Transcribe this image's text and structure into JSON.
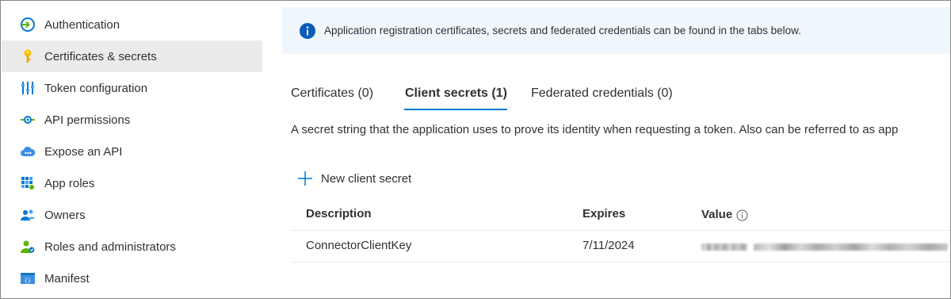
{
  "sidebar": {
    "items": [
      {
        "label": "Authentication",
        "icon": "authentication-icon",
        "active": false
      },
      {
        "label": "Certificates & secrets",
        "icon": "key-icon",
        "active": true
      },
      {
        "label": "Token configuration",
        "icon": "token-config-icon",
        "active": false
      },
      {
        "label": "API permissions",
        "icon": "api-permissions-icon",
        "active": false
      },
      {
        "label": "Expose an API",
        "icon": "cloud-icon",
        "active": false
      },
      {
        "label": "App roles",
        "icon": "app-roles-icon",
        "active": false
      },
      {
        "label": "Owners",
        "icon": "owners-icon",
        "active": false
      },
      {
        "label": "Roles and administrators",
        "icon": "roles-admin-icon",
        "active": false
      },
      {
        "label": "Manifest",
        "icon": "manifest-icon",
        "active": false
      }
    ]
  },
  "banner": {
    "text": "Application registration certificates, secrets and federated credentials can be found in the tabs below."
  },
  "tabs": [
    {
      "label": "Certificates (0)",
      "active": false
    },
    {
      "label": "Client secrets (1)",
      "active": true
    },
    {
      "label": "Federated credentials (0)",
      "active": false
    }
  ],
  "description": "A secret string that the application uses to prove its identity when requesting a token. Also can be referred to as app",
  "new_secret": {
    "label": "New client secret"
  },
  "table": {
    "headers": {
      "description": "Description",
      "expires": "Expires",
      "value": "Value"
    },
    "rows": [
      {
        "description": "ConnectorClientKey",
        "expires": "7/11/2024",
        "value_hidden": true
      }
    ]
  },
  "colors": {
    "accent": "#0078d4",
    "banner_bg": "#eff6fc",
    "active_nav_bg": "#edebe9"
  }
}
